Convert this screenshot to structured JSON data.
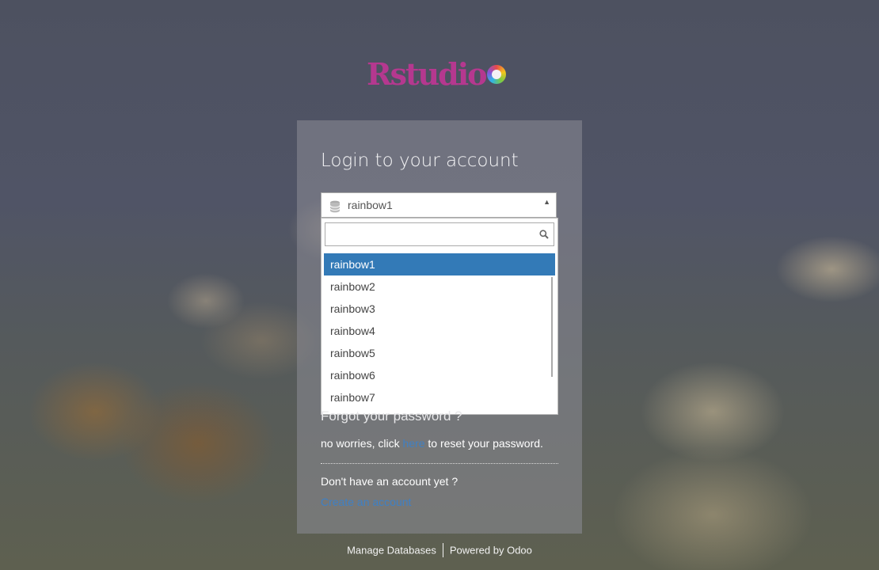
{
  "brand": {
    "logo_text": "Rstudio"
  },
  "login": {
    "title": "Login to your account",
    "database_select": {
      "selected_value": "rainbow1",
      "search_value": "",
      "options": [
        "rainbow1",
        "rainbow2",
        "rainbow3",
        "rainbow4",
        "rainbow5",
        "rainbow6",
        "rainbow7"
      ]
    },
    "forgot_password": "Forgot your password ?",
    "reset_prefix": "no worries, click",
    "reset_link": "here",
    "reset_suffix": "to reset your password.",
    "no_account": "Don't have an account yet ?",
    "create_account": "Create an account"
  },
  "footer": {
    "manage_databases": "Manage Databases",
    "powered_by": "Powered by Odoo"
  },
  "colors": {
    "accent": "#337ab7",
    "link": "#3f80c4",
    "brand": "#b5388f"
  },
  "icons": [
    "database-icon",
    "search-icon",
    "caret-up-icon"
  ]
}
